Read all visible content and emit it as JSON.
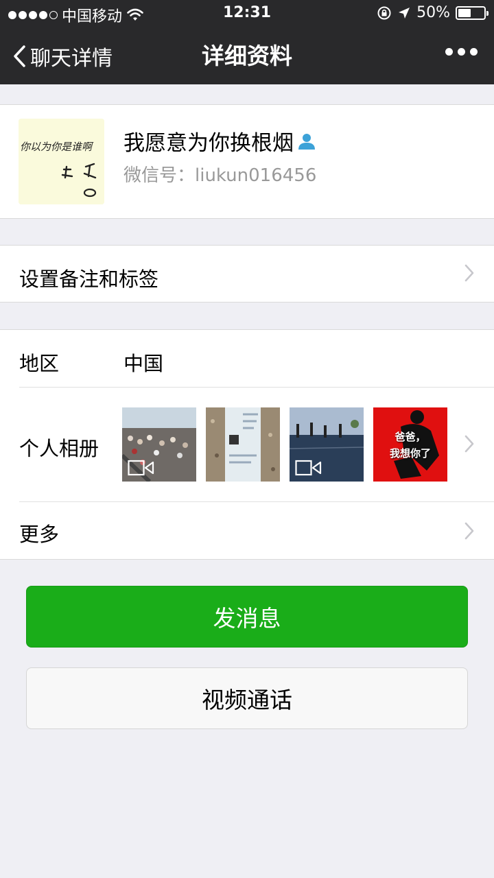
{
  "status_bar": {
    "carrier": "中国移动",
    "time": "12:31",
    "battery": "50%",
    "battery_level": 0.5
  },
  "nav": {
    "back_label": "聊天详情",
    "title": "详细资料"
  },
  "profile": {
    "name": "我愿意为你换根烟",
    "wechat_id": "微信号：liukun016456",
    "avatar_text": "你以为你是谁啊"
  },
  "remark_row": {
    "label": "设置备注和标签"
  },
  "region_row": {
    "label": "地区",
    "value": "中国"
  },
  "album_row": {
    "label": "个人相册",
    "thumbnails": [
      {
        "type": "video"
      },
      {
        "type": "image"
      },
      {
        "type": "video"
      },
      {
        "type": "image",
        "text_line1": "爸爸，",
        "text_line2": "我想你了"
      }
    ]
  },
  "more_row": {
    "label": "更多"
  },
  "buttons": {
    "send_message": "发消息",
    "video_call": "视频通话"
  },
  "colors": {
    "nav_bg": "#29292b",
    "primary_green": "#1aad19",
    "page_bg": "#efeff4"
  }
}
